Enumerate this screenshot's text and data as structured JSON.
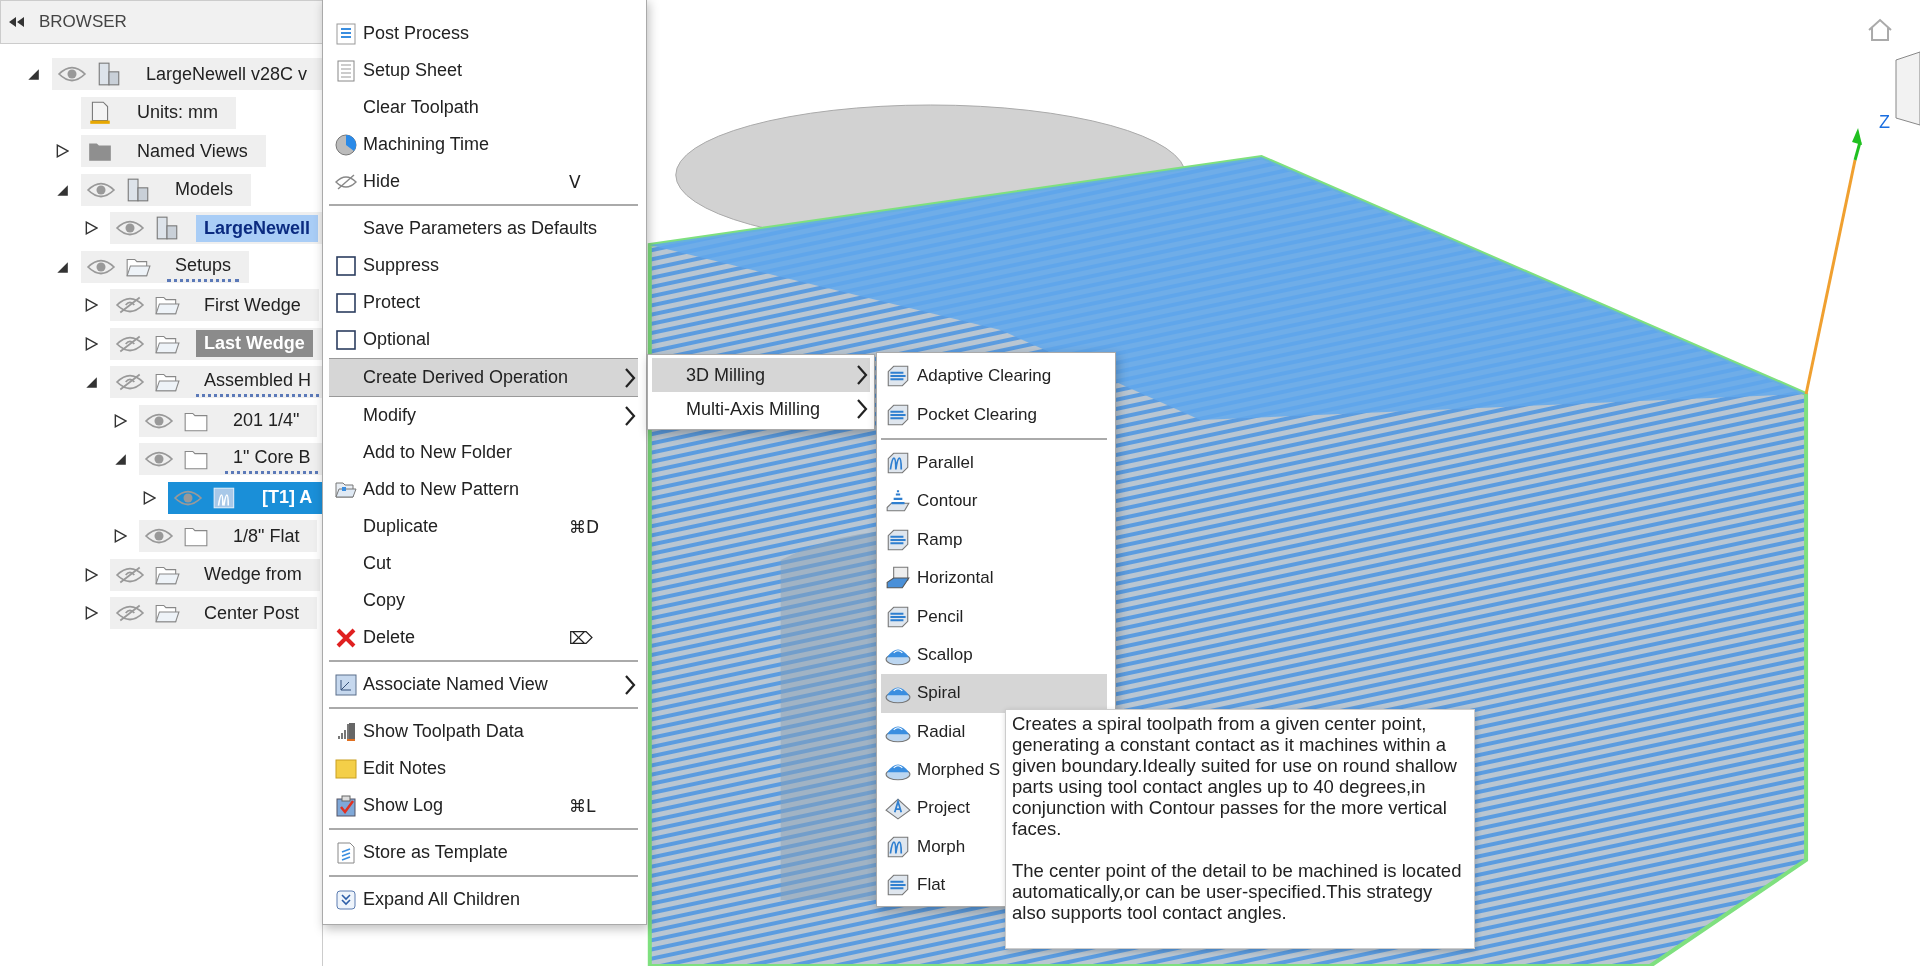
{
  "browser": {
    "title": "BROWSER",
    "tree": [
      {
        "label": "LargeNewell v28C v",
        "expanded": true,
        "visible": true,
        "kind": "component",
        "selected": false,
        "children": [
          {
            "label": "Units: mm",
            "kind": "document",
            "selected": false
          },
          {
            "label": "Named Views",
            "expanded": false,
            "kind": "folder-dark",
            "selected": false
          },
          {
            "label": "Models",
            "expanded": true,
            "visible": true,
            "kind": "component",
            "selected": false,
            "children": [
              {
                "label": "LargeNewell",
                "expanded": false,
                "visible": true,
                "kind": "component",
                "active": true,
                "selected": false
              }
            ]
          },
          {
            "label": "Setups",
            "expanded": true,
            "visible": true,
            "kind": "setup-folder",
            "hatched": true,
            "selected": false,
            "children": [
              {
                "label": "First Wedge",
                "expanded": false,
                "visible": false,
                "kind": "setup-folder",
                "selected": false
              },
              {
                "label": "Last Wedge",
                "expanded": false,
                "visible": false,
                "kind": "setup-folder",
                "greyed": true,
                "selected": false
              },
              {
                "label": "Assembled H",
                "expanded": true,
                "visible": false,
                "kind": "setup-folder",
                "hatched": true,
                "selected": false,
                "children": [
                  {
                    "label": "201 1/4\"",
                    "expanded": false,
                    "visible": true,
                    "kind": "folder",
                    "selected": false
                  },
                  {
                    "label": "1\" Core B",
                    "expanded": true,
                    "visible": true,
                    "kind": "folder",
                    "hatched": true,
                    "selected": false,
                    "children": [
                      {
                        "label": "[T1] A",
                        "expanded": false,
                        "visible": true,
                        "kind": "toolpath",
                        "selected": true
                      }
                    ]
                  },
                  {
                    "label": "1/8\" Flat",
                    "expanded": false,
                    "visible": true,
                    "kind": "folder",
                    "selected": false
                  }
                ]
              },
              {
                "label": "Wedge from",
                "expanded": false,
                "visible": false,
                "kind": "setup-folder",
                "selected": false
              },
              {
                "label": "Center Post",
                "expanded": false,
                "visible": false,
                "kind": "setup-folder",
                "selected": false
              }
            ]
          }
        ]
      }
    ]
  },
  "context_menu": [
    {
      "label": "Post Process",
      "kind": "code-sheet",
      "selected": false
    },
    {
      "label": "Setup Sheet",
      "kind": "document",
      "selected": false
    },
    {
      "label": "Clear Toolpath",
      "kind": "plain",
      "selected": false
    },
    {
      "label": "Machining Time",
      "kind": "pie",
      "selected": false
    },
    {
      "label": "Hide",
      "kind": "hidden-eye",
      "shortcut": "V",
      "separator_after": true,
      "selected": false
    },
    {
      "label": "Save Parameters as Defaults",
      "kind": "plain",
      "selected": false
    },
    {
      "label": "Suppress",
      "kind": "checkbox",
      "checked": false,
      "selected": false
    },
    {
      "label": "Protect",
      "kind": "checkbox",
      "checked": false,
      "selected": false
    },
    {
      "label": "Optional",
      "kind": "checkbox",
      "checked": false,
      "selected": false
    },
    {
      "label": "Create Derived Operation",
      "kind": "plain",
      "submenu": true,
      "selected": true
    },
    {
      "label": "Modify",
      "kind": "plain",
      "submenu": true,
      "selected": false
    },
    {
      "label": "Add to New Folder",
      "kind": "plain",
      "selected": false
    },
    {
      "label": "Add to New Pattern",
      "kind": "open-folder",
      "selected": false
    },
    {
      "label": "Duplicate",
      "kind": "plain",
      "shortcut": "⌘D",
      "selected": false
    },
    {
      "label": "Cut",
      "kind": "plain",
      "selected": false
    },
    {
      "label": "Copy",
      "kind": "plain",
      "selected": false
    },
    {
      "label": "Delete",
      "kind": "delete",
      "shortcut": "⌦",
      "separator_after": true,
      "selected": false
    },
    {
      "label": "Associate Named View",
      "kind": "view",
      "submenu": true,
      "separator_after": true,
      "selected": false
    },
    {
      "label": "Show Toolpath Data",
      "kind": "bars",
      "selected": false
    },
    {
      "label": "Edit Notes",
      "kind": "note",
      "selected": false
    },
    {
      "label": "Show Log",
      "kind": "clipboard",
      "shortcut": "⌘L",
      "separator_after": true,
      "selected": false
    },
    {
      "label": "Store as Template",
      "kind": "template",
      "separator_after": true,
      "selected": false
    },
    {
      "label": "Expand All Children",
      "kind": "expand",
      "selected": false
    }
  ],
  "derived_submenu": [
    {
      "label": "3D Milling",
      "selected": true
    },
    {
      "label": "Multi-Axis Milling",
      "selected": false
    }
  ],
  "milling_submenu": [
    {
      "label": "Adaptive Clearing",
      "kind": "layers",
      "selected": false
    },
    {
      "label": "Pocket Clearing",
      "kind": "layers",
      "separator_after": true,
      "selected": false
    },
    {
      "label": "Parallel",
      "kind": "waves",
      "selected": false
    },
    {
      "label": "Contour",
      "kind": "steps",
      "selected": false
    },
    {
      "label": "Ramp",
      "kind": "layers",
      "selected": false
    },
    {
      "label": "Horizontal",
      "kind": "flat-block",
      "selected": false
    },
    {
      "label": "Pencil",
      "kind": "layers",
      "selected": false
    },
    {
      "label": "Scallop",
      "kind": "dome",
      "selected": false
    },
    {
      "label": "Spiral",
      "kind": "dome",
      "selected": true
    },
    {
      "label": "Radial",
      "kind": "dome",
      "selected": false
    },
    {
      "label": "Morphed S",
      "kind": "dome",
      "selected": false
    },
    {
      "label": "Project",
      "kind": "diamond",
      "selected": false
    },
    {
      "label": "Morph",
      "kind": "waves",
      "selected": false
    },
    {
      "label": "Flat",
      "kind": "layers",
      "selected": false
    }
  ],
  "tooltip": [
    "Creates a spiral toolpath from a given center point, generating a constant contact as it machines within a given boundary.Ideally suited for use on round shallow parts using tool contact angles up to 40 degrees,in conjunction with Contour passes for the more vertical faces.",
    "The center point of the detail to be machined is located automatically,or can be user-specified.This strategy also supports tool contact angles."
  ],
  "viewport": {
    "axis_label": "Z"
  }
}
